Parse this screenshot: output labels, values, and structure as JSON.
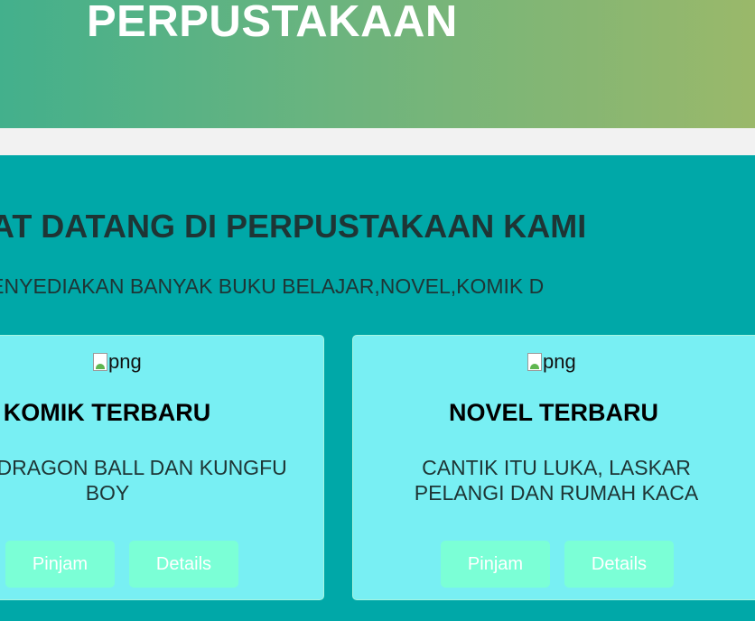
{
  "header": {
    "title": "PERPUSTAKAAN"
  },
  "main": {
    "welcome": "MAT DATANG DI PERPUSTAKAAN KAMI",
    "subtitle": "MENYEDIAKAN BANYAK BUKU BELAJAR,NOVEL,KOMIK D"
  },
  "cards": [
    {
      "image_alt": "png",
      "title": "KOMIK TERBARU",
      "description": "D GUY,DRAGON BALL DAN KUNGFU BOY",
      "pinjam_label": "Pinjam",
      "details_label": "Details"
    },
    {
      "image_alt": "png",
      "title": "NOVEL TERBARU",
      "description": "CANTIK ITU LUKA, LASKAR PELANGI DAN RUMAH KACA",
      "pinjam_label": "Pinjam",
      "details_label": "Details"
    }
  ],
  "colors": {
    "header_gradient_start": "#43b08c",
    "header_gradient_end": "#9ab86a",
    "main_background": "#00a8a8",
    "card_background": "#78eff3",
    "button_background": "#7bffd6",
    "heading_text": "#1e3535"
  },
  "icons": {
    "broken_image": "broken-image-icon"
  }
}
